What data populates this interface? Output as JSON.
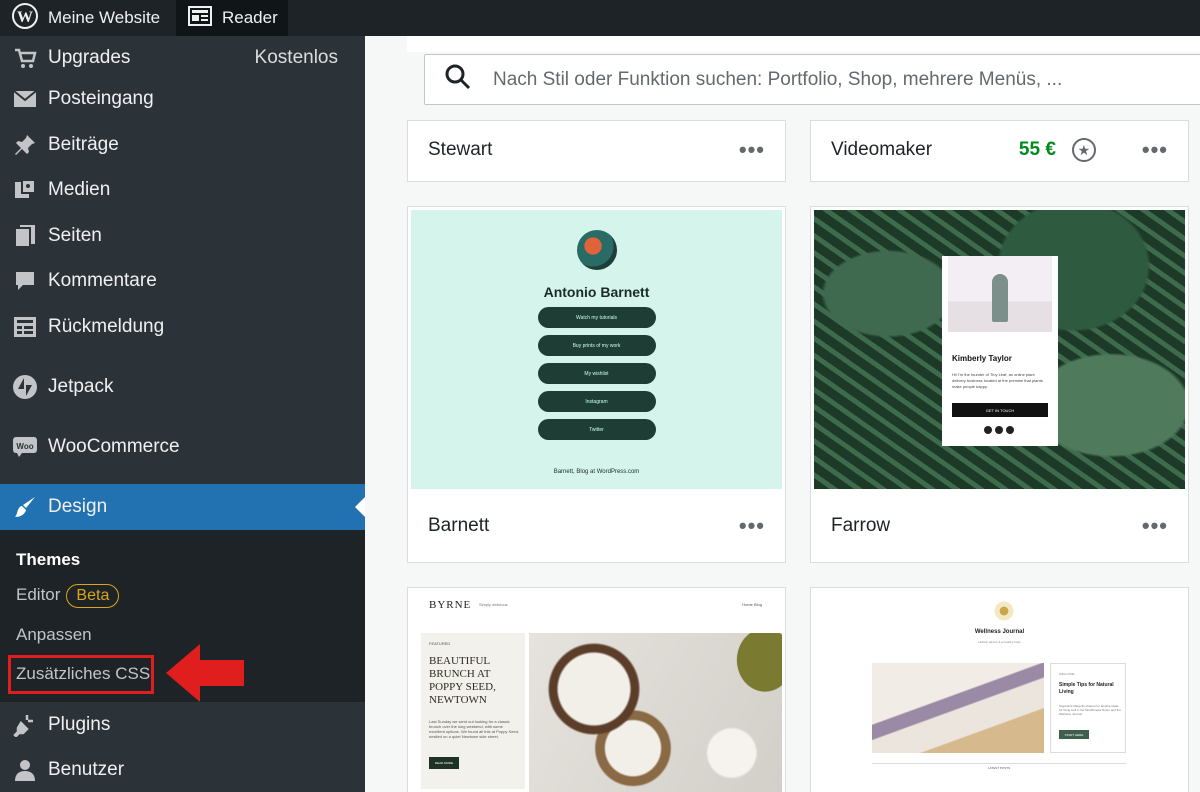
{
  "topbar": {
    "site_label": "Meine Website",
    "reader_label": "Reader"
  },
  "sidebar": {
    "items": [
      {
        "label": "Upgrades",
        "extra": "Kostenlos",
        "icon": "cart-icon"
      },
      {
        "label": "Posteingang",
        "icon": "mail-icon"
      },
      {
        "label": "Beiträge",
        "icon": "pin-icon"
      },
      {
        "label": "Medien",
        "icon": "media-icon"
      },
      {
        "label": "Seiten",
        "icon": "pages-icon"
      },
      {
        "label": "Kommentare",
        "icon": "comment-icon"
      },
      {
        "label": "Rückmeldung",
        "icon": "feedback-icon"
      },
      {
        "label": "Jetpack",
        "icon": "jetpack-icon"
      },
      {
        "label": "WooCommerce",
        "icon": "woo-icon"
      },
      {
        "label": "Design",
        "icon": "brush-icon",
        "active": true
      },
      {
        "label": "Plugins",
        "icon": "plugin-icon"
      },
      {
        "label": "Benutzer",
        "icon": "user-icon"
      }
    ],
    "submenu": {
      "themes": "Themes",
      "editor": "Editor",
      "editor_badge": "Beta",
      "customize": "Anpassen",
      "additional_css": "Zusätzliches CSS"
    }
  },
  "search": {
    "placeholder": "Nach Stil oder Funktion suchen: Portfolio, Shop, mehrere Menüs, ..."
  },
  "themes": [
    {
      "name": "Stewart",
      "menu": "•••"
    },
    {
      "name": "Videomaker",
      "price": "55 €",
      "menu": "•••"
    },
    {
      "name": "Barnett",
      "menu": "•••"
    },
    {
      "name": "Farrow",
      "menu": "•••"
    }
  ],
  "previews": {
    "barnett": {
      "name": "Antonio Barnett",
      "buttons": [
        "Watch my tutorials",
        "Buy prints of my work",
        "My wishlist",
        "Instagram",
        "Twitter"
      ],
      "footer": "Barnett, Blog at WordPress.com"
    },
    "farrow": {
      "name": "Kimberly Taylor",
      "text": "Hi! I'm the founder of Tiny Leaf, an online plant delivery business located at the premise that plants make people happy.",
      "button": "GET IN TOUCH"
    },
    "byrne": {
      "brand": "BYRNE",
      "tagline": "Simply delicious",
      "nav": "Home   Blog",
      "featured": "FEATURED",
      "headline": "BEAUTIFUL BRUNCH AT POPPY SEED, NEWTOWN",
      "excerpt": "Last Sunday we went out looking for a classic brunch over the long weekend, with some excellent options. We found all this at Poppy Seed, nestled on a quiet Newtown side street.",
      "button": "READ MORE"
    },
    "wellness": {
      "title": "Wellness Journal",
      "subtitle": "Holistic advice & a healthy body",
      "side_label": "WELCOME",
      "side_title": "Simple Tips for Natural Living",
      "side_text": "Stephanie Margolin shares her favorite ideas for living well in the Mindfulness Room and the Wellness Journal.",
      "side_button": "START HERE",
      "latest": "LATEST POSTS"
    }
  },
  "colors": {
    "topbar": "#1d2327",
    "sidebar": "#2c3338",
    "active": "#2271b1",
    "badge": "#dba617",
    "highlight": "#e11e1e",
    "price": "#008a20"
  }
}
